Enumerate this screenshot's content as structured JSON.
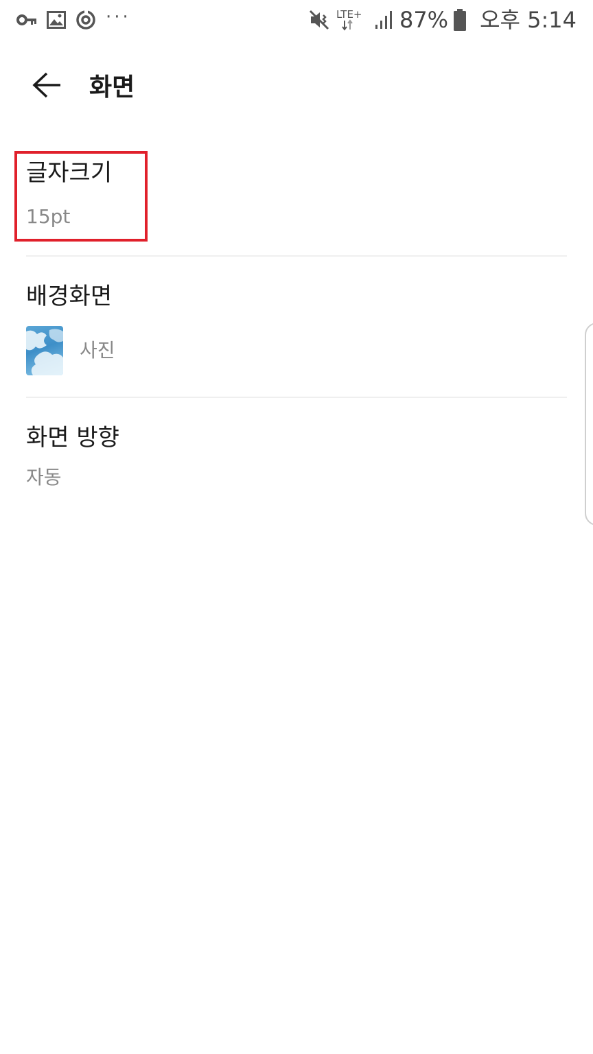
{
  "status_bar": {
    "left_icons": [
      "key-icon",
      "image-icon",
      "sync-icon"
    ],
    "more": "···",
    "network": "LTE+",
    "battery_percent": "87%",
    "time": "오후 5:14"
  },
  "app_bar": {
    "title": "화면"
  },
  "settings": {
    "font_size": {
      "title": "글자크기",
      "value": "15pt"
    },
    "background": {
      "title": "배경화면",
      "value": "사진"
    },
    "orientation": {
      "title": "화면 방향",
      "value": "자동"
    }
  },
  "colors": {
    "highlight": "#e0202b",
    "secondary_text": "#888888",
    "divider": "#efefef"
  }
}
